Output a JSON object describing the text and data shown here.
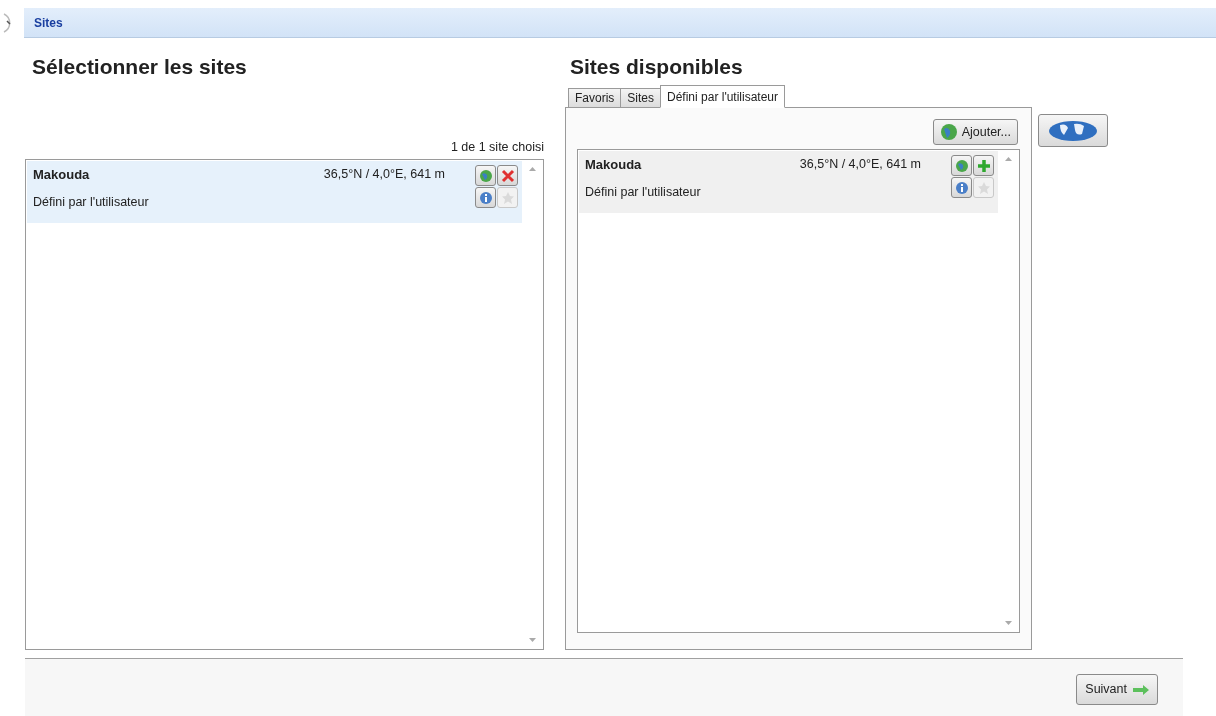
{
  "header": {
    "title": "Sites"
  },
  "selected_panel": {
    "title": "Sélectionner les sites",
    "count": "1 de 1 site choisi",
    "items": [
      {
        "name": "Makouda",
        "coords": "36,5°N / 4,0°E, 641 m",
        "source": "Défini par l'utilisateur",
        "actions": [
          {
            "kind": "globe",
            "disabled": false
          },
          {
            "kind": "remove",
            "disabled": false
          },
          {
            "kind": "info",
            "disabled": false
          },
          {
            "kind": "star",
            "disabled": true
          }
        ]
      }
    ]
  },
  "available_panel": {
    "title": "Sites disponibles",
    "tabs": [
      {
        "label": "Favoris",
        "selected": false
      },
      {
        "label": "Sites",
        "selected": false
      },
      {
        "label": "Défini par l'utilisateur",
        "selected": true
      }
    ],
    "add_button": "Ajouter...",
    "items": [
      {
        "name": "Makouda",
        "coords": "36,5°N / 4,0°E, 641 m",
        "source": "Défini par l'utilisateur",
        "actions": [
          {
            "kind": "globe",
            "disabled": false
          },
          {
            "kind": "add",
            "disabled": false
          },
          {
            "kind": "info",
            "disabled": false
          },
          {
            "kind": "star",
            "disabled": true
          }
        ]
      }
    ]
  },
  "footer": {
    "next_button": "Suivant"
  }
}
